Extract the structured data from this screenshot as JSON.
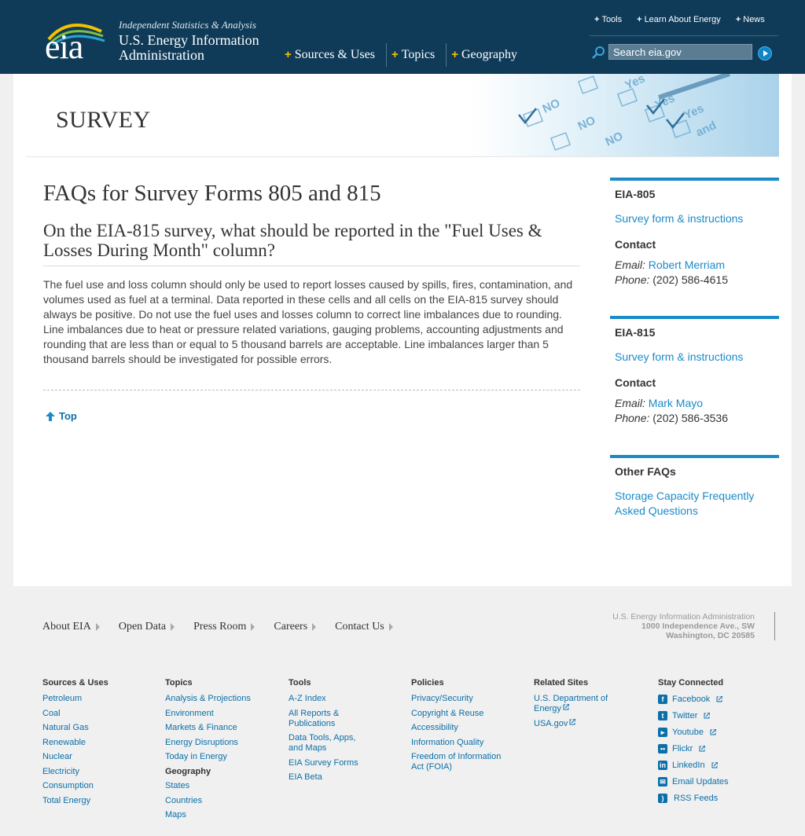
{
  "header": {
    "logo_text": "eia",
    "tagline": "Independent Statistics & Analysis",
    "org_name": "U.S. Energy Information Administration",
    "nav": [
      {
        "label": "Sources & Uses"
      },
      {
        "label": "Topics"
      },
      {
        "label": "Geography"
      }
    ],
    "util_nav": [
      {
        "label": "Tools"
      },
      {
        "label": "Learn About Energy"
      },
      {
        "label": "News"
      }
    ],
    "search": {
      "placeholder": "Search eia.gov"
    }
  },
  "banner": {
    "title": "SURVEY"
  },
  "main": {
    "title": "FAQs for Survey Forms 805 and 815",
    "question": "On the EIA-815 survey, what should be reported in the \"Fuel Uses & Losses During Month\" column?",
    "answer": "The fuel use and loss column should only be used to report losses caused by spills, fires, contamination, and volumes used as fuel at a terminal. Data reported in these cells and all cells on the EIA-815 survey should always be positive. Do not use the fuel uses and losses column to correct line imbalances due to rounding. Line imbalances due to heat or pressure related variations, gauging problems, accounting adjustments and rounding that are less than or equal to 5 thousand barrels are acceptable. Line imbalances larger than 5 thousand barrels should be investigated for possible errors.",
    "top_link": "Top"
  },
  "sidebar": {
    "eia805": {
      "heading": "EIA-805",
      "link": "Survey form & instructions",
      "contact_heading": "Contact",
      "email_label": "Email:",
      "email_name": "Robert Merriam",
      "phone_label": "Phone:",
      "phone": "(202) 586-4615"
    },
    "eia815": {
      "heading": "EIA-815",
      "link": "Survey form & instructions",
      "contact_heading": "Contact",
      "email_label": "Email:",
      "email_name": "Mark Mayo",
      "phone_label": "Phone:",
      "phone": "(202) 586-3536"
    },
    "other": {
      "heading": "Other FAQs",
      "link": "Storage Capacity Frequently Asked Questions"
    }
  },
  "footer": {
    "nav": [
      "About EIA",
      "Open Data",
      "Press Room",
      "Careers",
      "Contact Us"
    ],
    "address": {
      "line1": "U.S. Energy Information Administration",
      "line2": "1000 Independence Ave., SW",
      "line3": "Washington, DC 20585"
    },
    "sources": {
      "heading": "Sources & Uses",
      "links": [
        "Petroleum",
        "Coal",
        "Natural Gas",
        "Renewable",
        "Nuclear",
        "Electricity",
        "Consumption",
        "Total Energy"
      ]
    },
    "topics": {
      "heading": "Topics",
      "links": [
        "Analysis & Projections",
        "Environment",
        "Markets & Finance",
        "Energy Disruptions",
        "Today in Energy"
      ],
      "subheading": "Geography",
      "sublinks": [
        "States",
        "Countries",
        "Maps"
      ]
    },
    "tools": {
      "heading": "Tools",
      "links": [
        "A-Z Index",
        "All Reports & Publications",
        "Data Tools, Apps, and Maps",
        "EIA Survey Forms",
        "EIA Beta"
      ]
    },
    "policies": {
      "heading": "Policies",
      "links": [
        "Privacy/Security",
        "Copyright & Reuse",
        "Accessibility",
        "Information Quality",
        "Freedom of Information Act (FOIA)"
      ]
    },
    "related": {
      "heading": "Related Sites",
      "links": [
        "U.S. Department of Energy",
        "USA.gov"
      ]
    },
    "connected": {
      "heading": "Stay Connected",
      "links": [
        {
          "label": "Facebook",
          "icon": "facebook-icon"
        },
        {
          "label": "Twitter",
          "icon": "twitter-icon"
        },
        {
          "label": "Youtube",
          "icon": "youtube-icon"
        },
        {
          "label": "Flickr",
          "icon": "flickr-icon"
        },
        {
          "label": "LinkedIn",
          "icon": "linkedin-icon"
        },
        {
          "label": "Email Updates",
          "icon": "email-icon"
        },
        {
          "label": "RSS Feeds",
          "icon": "rss-icon"
        }
      ]
    }
  },
  "colors": {
    "header_bg": "#0f3b58",
    "accent": "#1a8ac9",
    "link": "#0c6fa8",
    "nav_plus": "#f2c200"
  }
}
